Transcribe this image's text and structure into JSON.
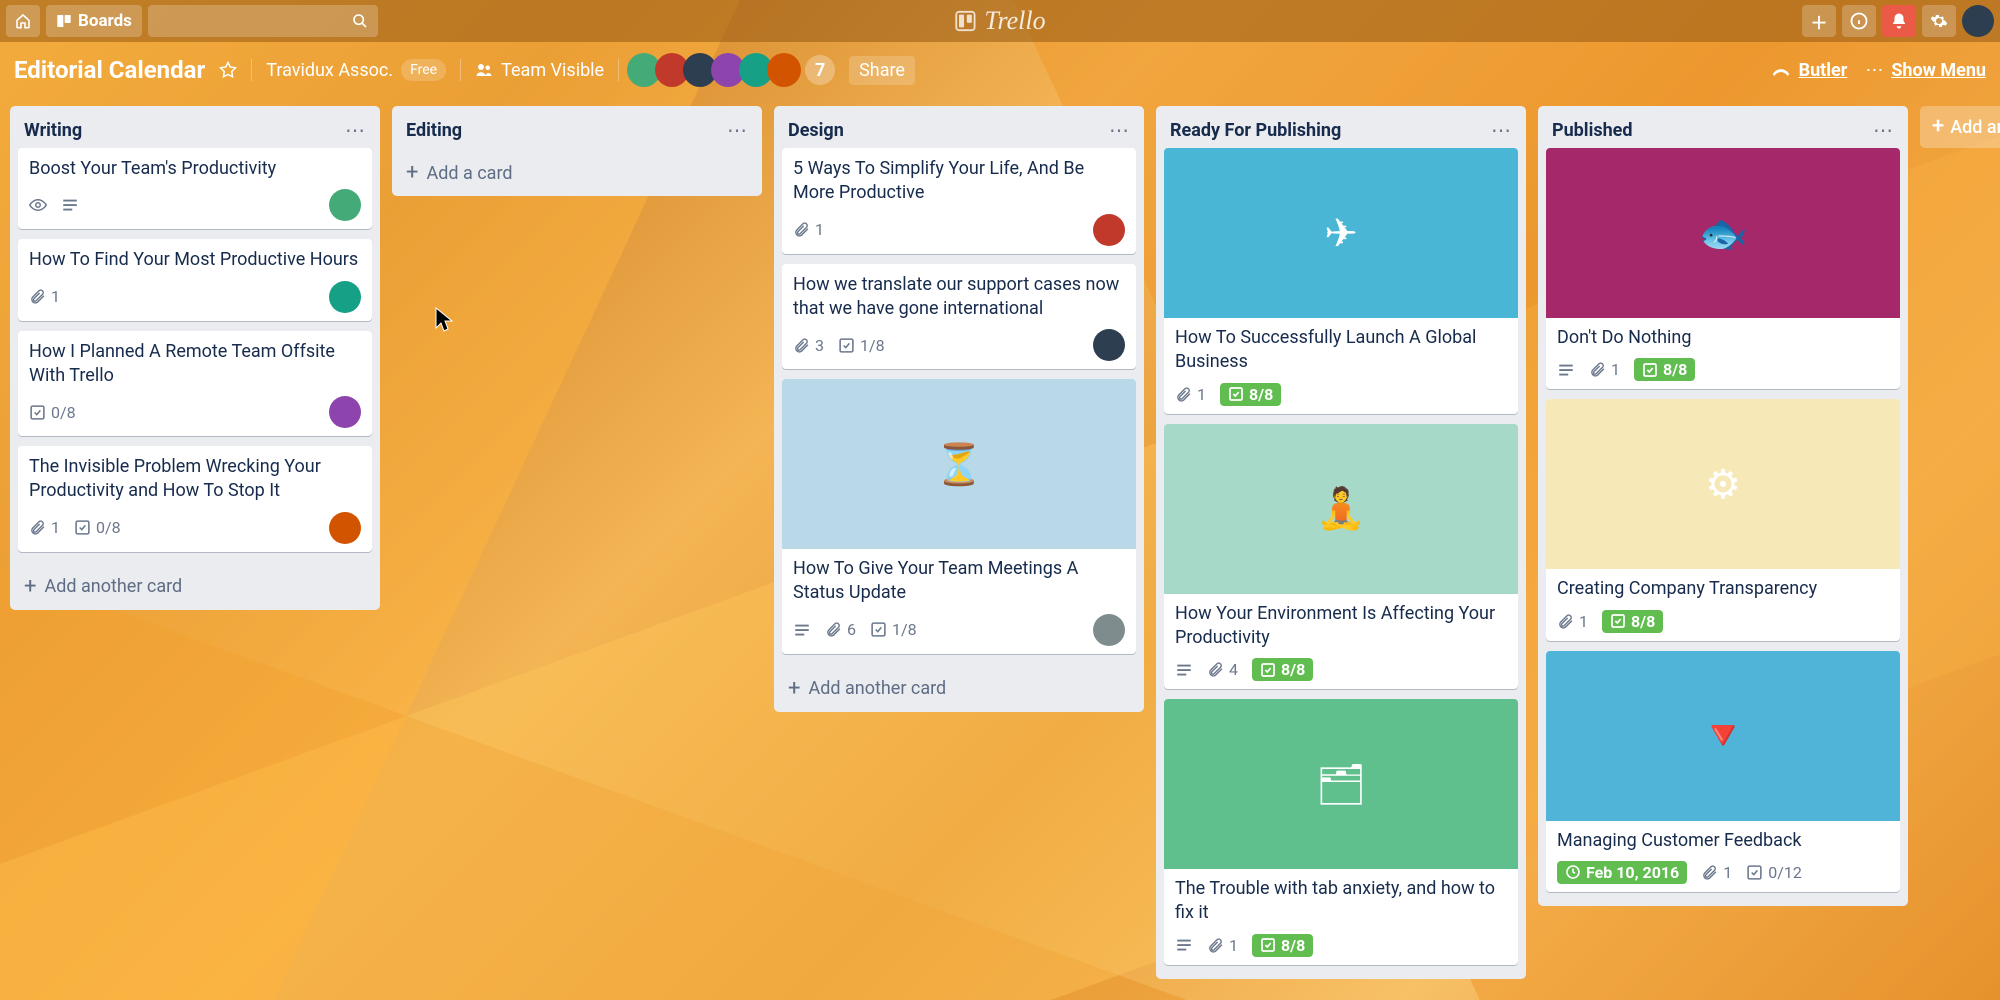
{
  "topbar": {
    "boards_label": "Boards",
    "logo_text": "Trello"
  },
  "board_header": {
    "name": "Editorial Calendar",
    "team": "Travidux Assoc.",
    "team_badge": "Free",
    "visibility": "Team Visible",
    "member_overflow": "7",
    "share": "Share",
    "butler": "Butler",
    "show_menu": "Show Menu"
  },
  "lists": [
    {
      "title": "Writing",
      "add_label": "Add another card",
      "cards": [
        {
          "title": "Boost Your Team's Productivity",
          "watch": true,
          "desc": true,
          "avatar": "a"
        },
        {
          "title": "How To Find Your Most Productive Hours",
          "attachments": "1",
          "avatar": "e"
        },
        {
          "title": "How I Planned A Remote Team Offsite With Trello",
          "checklist": "0/8",
          "avatar": "d"
        },
        {
          "title": "The Invisible Problem Wrecking Your Productivity and How To Stop It",
          "attachments": "1",
          "checklist": "0/8",
          "avatar": "f"
        }
      ]
    },
    {
      "title": "Editing",
      "add_label": "Add a card",
      "cards": []
    },
    {
      "title": "Design",
      "add_label": "Add another card",
      "cards": [
        {
          "title": "5 Ways To Simplify Your Life, And Be More Productive",
          "attachments": "1",
          "avatar": "b"
        },
        {
          "title": "How we translate our support cases now that we have gone international",
          "attachments": "3",
          "checklist": "1/8",
          "avatar": "c"
        },
        {
          "title": "How To Give Your Team Meetings A Status Update",
          "cover": "#b9d8e8",
          "cover_icon": "hourglass",
          "desc": true,
          "attachments": "6",
          "checklist": "1/8",
          "avatar": "g"
        }
      ]
    },
    {
      "title": "Ready For Publishing",
      "cards": [
        {
          "title": "How To Successfully Launch A Global Business",
          "cover": "#49b6d6",
          "cover_icon": "plane",
          "attachments": "1",
          "checklist_done": "8/8"
        },
        {
          "title": "How Your Environment Is Affecting Your Productivity",
          "cover": "#a6d9c7",
          "cover_icon": "desk",
          "desc": true,
          "attachments": "4",
          "checklist_done": "8/8"
        },
        {
          "title": "The Trouble with tab anxiety, and how to fix it",
          "cover": "#5fc08e",
          "cover_icon": "tabs",
          "desc": true,
          "attachments": "1",
          "checklist_done": "8/8"
        }
      ]
    },
    {
      "title": "Published",
      "cards": [
        {
          "title": "Don't Do Nothing",
          "cover": "#a4286a",
          "cover_icon": "fish",
          "desc": true,
          "attachments": "1",
          "checklist_done": "8/8"
        },
        {
          "title": "Creating Company Transparency",
          "cover": "#f7e9b7",
          "cover_icon": "gears",
          "attachments": "1",
          "checklist_done": "8/8"
        },
        {
          "title": "Managing Customer Feedback",
          "cover": "#4fb4d8",
          "cover_icon": "funnel",
          "due": "Feb 10, 2016",
          "attachments": "1",
          "checklist": "0/12"
        }
      ]
    }
  ],
  "add_list_label": "Add anothe"
}
